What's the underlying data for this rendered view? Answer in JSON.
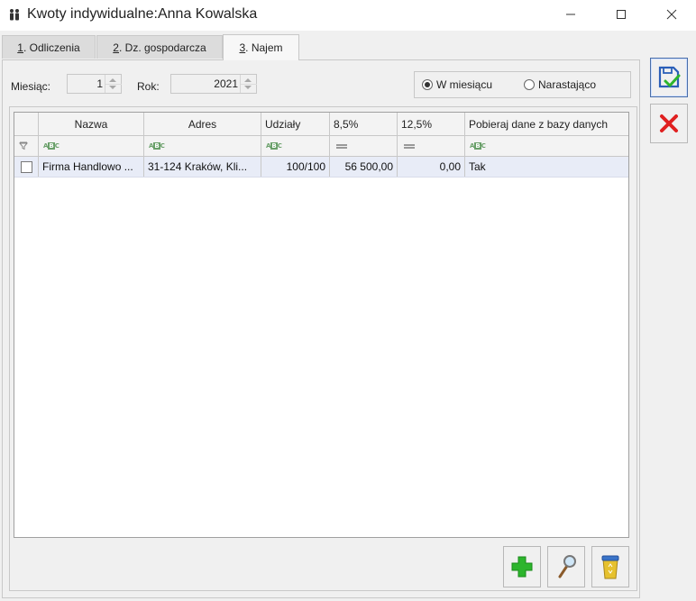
{
  "window": {
    "title": "Kwoty indywidualne:Anna Kowalska",
    "app_icon": "people-icon"
  },
  "tabs": [
    {
      "num": "1",
      "label": " . Odliczenia",
      "active": false
    },
    {
      "num": "2",
      "label": " . Dz. gospodarcza",
      "active": false
    },
    {
      "num": "3",
      "label": " . Najem",
      "active": true
    }
  ],
  "filters": {
    "month_label": "Miesiąc:",
    "month_value": "1",
    "year_label": "Rok:",
    "year_value": "2021",
    "mode_options": [
      {
        "label": "W miesiącu",
        "selected": true
      },
      {
        "label": "Narastająco",
        "selected": false
      }
    ]
  },
  "grid": {
    "columns": [
      "",
      "Nazwa",
      "Adres",
      "Udziały",
      "8,5%",
      "12,5%",
      "Pobieraj dane z bazy danych"
    ],
    "filter_icons": [
      "funnel-icon",
      "text-filter-icon",
      "text-filter-icon",
      "text-filter-icon",
      "equals-filter-icon",
      "equals-filter-icon",
      "text-filter-icon"
    ],
    "rows": [
      {
        "checked": false,
        "nazwa": "Firma Handlowo ...",
        "adres": "31-124 Kraków, Kli...",
        "udzialy": "100/100",
        "p85": "56 500,00",
        "p125": "0,00",
        "pobieraj": "Tak"
      }
    ]
  },
  "buttons": {
    "add": "add-icon",
    "preview": "magnifier-icon",
    "delete": "trash-icon",
    "save": "save-icon",
    "cancel": "cancel-icon"
  },
  "colors": {
    "selected_row": "#e8ecf7",
    "add_green": "#2db52d",
    "cancel_red": "#e02020",
    "save_blue": "#2b5fb8"
  }
}
